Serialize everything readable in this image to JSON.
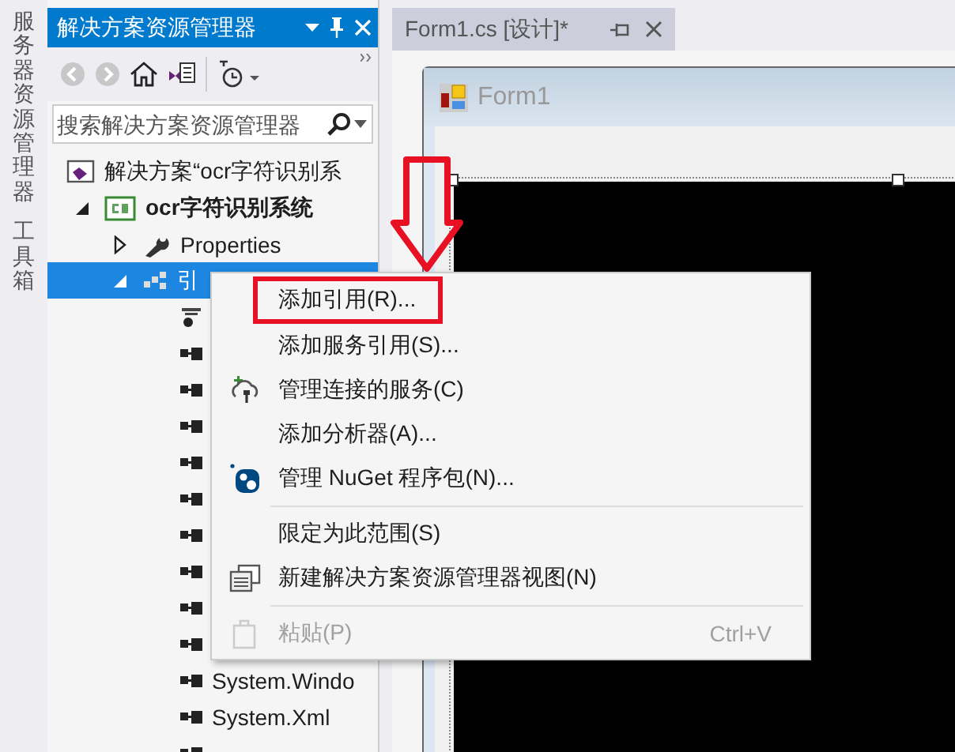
{
  "side_tabs": [
    {
      "label": "服务器资源管理器"
    },
    {
      "label": "工具箱"
    }
  ],
  "solution_explorer": {
    "title": "解决方案资源管理器",
    "search": {
      "placeholder": "搜索解决方案资源管理器"
    },
    "tree": [
      {
        "kind": "solution",
        "label": "解决方案“ocr字符识别系",
        "selected": false,
        "children": [
          {
            "kind": "project",
            "label": "ocr字符识别系统",
            "expanded": true,
            "selected": false,
            "children": [
              {
                "kind": "properties",
                "label": "Properties",
                "expanded": false,
                "selected": false
              },
              {
                "kind": "references",
                "label": "引",
                "expanded": true,
                "selected": true,
                "children": [
                  {
                    "kind": "analyzer",
                    "selected": false
                  },
                  {
                    "kind": "reference",
                    "selected": false
                  },
                  {
                    "kind": "reference",
                    "selected": false
                  },
                  {
                    "kind": "reference",
                    "selected": false
                  },
                  {
                    "kind": "reference",
                    "selected": false
                  },
                  {
                    "kind": "reference",
                    "selected": false
                  },
                  {
                    "kind": "reference",
                    "selected": false
                  },
                  {
                    "kind": "reference",
                    "selected": false
                  },
                  {
                    "kind": "reference",
                    "selected": false
                  },
                  {
                    "kind": "reference",
                    "selected": false
                  },
                  {
                    "kind": "reference",
                    "label": "System.Windo",
                    "selected": false
                  },
                  {
                    "kind": "reference",
                    "label": "System.Xml",
                    "selected": false
                  },
                  {
                    "kind": "reference",
                    "selected": false
                  }
                ]
              }
            ]
          }
        ]
      }
    ]
  },
  "document_tab": {
    "title": "Form1.cs [设计]*"
  },
  "designer": {
    "form_title": "Form1"
  },
  "context_menu": {
    "items": [
      {
        "kind": "plain",
        "label": "添加引用(R)...",
        "highlighted": true
      },
      {
        "kind": "plain",
        "label": "添加服务引用(S)...",
        "highlighted": false
      },
      {
        "kind": "services",
        "label": "管理连接的服务(C)",
        "highlighted": false
      },
      {
        "kind": "plain",
        "label": "添加分析器(A)...",
        "highlighted": false
      },
      {
        "kind": "package",
        "label": "管理 NuGet 程序包(N)...",
        "highlighted": false
      },
      {
        "kind": "separator"
      },
      {
        "kind": "plain",
        "label": "限定为此范围(S)",
        "highlighted": false
      },
      {
        "kind": "view",
        "label": "新建解决方案资源管理器视图(N)",
        "highlighted": false
      },
      {
        "kind": "separator"
      },
      {
        "kind": "clipboard",
        "label": "粘贴(P)",
        "shortcut": "Ctrl+V",
        "disabled": true,
        "highlighted": false
      }
    ]
  }
}
